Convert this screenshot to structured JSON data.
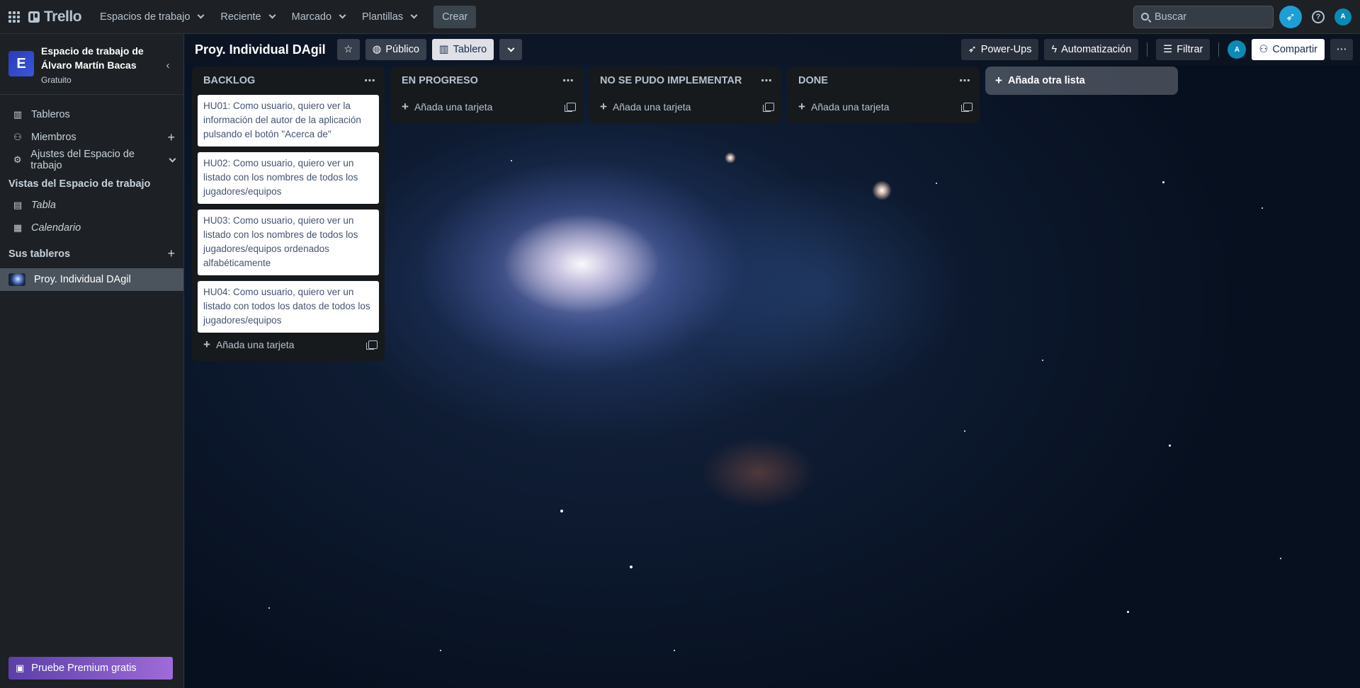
{
  "topnav": {
    "logo_text": "Trello",
    "menu": [
      {
        "label": "Espacios de trabajo"
      },
      {
        "label": "Reciente"
      },
      {
        "label": "Marcado"
      },
      {
        "label": "Plantillas"
      }
    ],
    "create_label": "Crear",
    "search_placeholder": "Buscar",
    "avatar_initial": "A"
  },
  "sidebar": {
    "workspace_initial": "E",
    "workspace_name": "Espacio de trabajo de Álvaro Martín Bacas",
    "workspace_plan": "Gratuito",
    "items": [
      {
        "label": "Tableros",
        "icon": "boards-icon"
      },
      {
        "label": "Miembros",
        "icon": "members-icon"
      },
      {
        "label": "Ajustes del Espacio de trabajo",
        "icon": "settings-icon"
      }
    ],
    "views_heading": "Vistas del Espacio de trabajo",
    "views": [
      {
        "label": "Tabla",
        "icon": "table-icon"
      },
      {
        "label": "Calendario",
        "icon": "calendar-icon"
      }
    ],
    "boards_heading": "Sus tableros",
    "boards": [
      {
        "label": "Proy. Individual DAgil"
      }
    ],
    "premium_label": "Pruebe Premium gratis"
  },
  "board": {
    "title": "Proy. Individual DAgil",
    "visibility_label": "Público",
    "view_label": "Tablero",
    "powerups_label": "Power-Ups",
    "automation_label": "Automatización",
    "filter_label": "Filtrar",
    "share_label": "Compartir",
    "member_initial": "A",
    "lists": [
      {
        "title": "BACKLOG",
        "cards": [
          {
            "text": "HU01: Como usuario, quiero ver la información del autor de la aplicación pulsando el botón \"Acerca de\""
          },
          {
            "text": "HU02: Como usuario, quiero ver un listado con los nombres de todos los jugadores/equipos"
          },
          {
            "text": "HU03: Como usuario, quiero ver un listado con los nombres de todos los jugadores/equipos ordenados alfabéticamente"
          },
          {
            "text": "HU04: Como usuario, quiero ver un listado con todos los datos de todos los jugadores/equipos"
          }
        ],
        "add_card_label": "Añada una tarjeta"
      },
      {
        "title": "EN PROGRESO",
        "cards": [],
        "add_card_label": "Añada una tarjeta"
      },
      {
        "title": "NO SE PUDO IMPLEMENTAR",
        "cards": [],
        "add_card_label": "Añada una tarjeta"
      },
      {
        "title": "DONE",
        "cards": [],
        "add_card_label": "Añada una tarjeta"
      }
    ],
    "add_list_label": "Añada otra lista"
  }
}
